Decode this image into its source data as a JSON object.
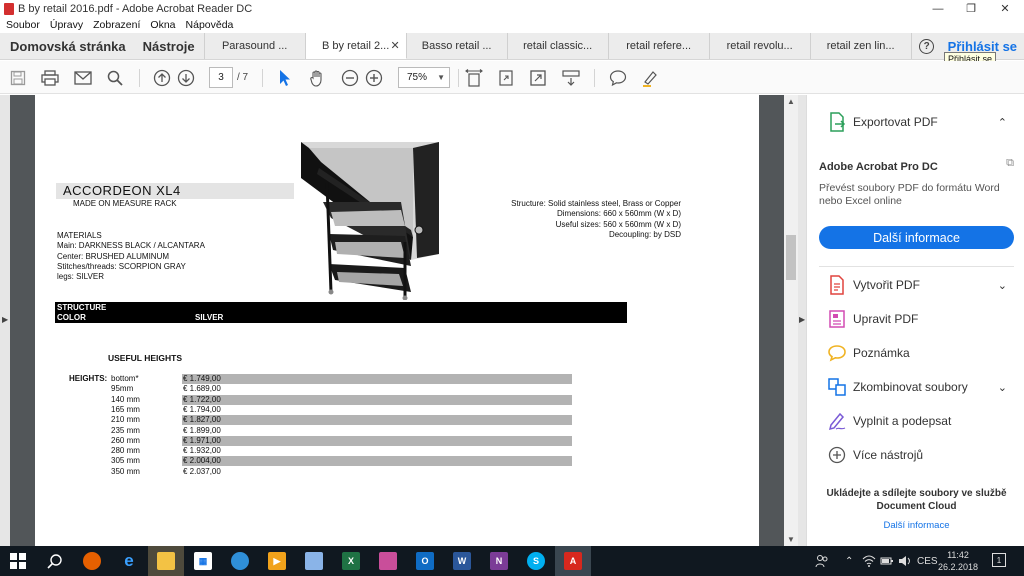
{
  "window": {
    "title": "B by retail 2016.pdf - Adobe Acrobat Reader DC",
    "minimize_label": "—",
    "maximize_label": "❐",
    "close_label": "✕"
  },
  "menubar": [
    "Soubor",
    "Úpravy",
    "Zobrazení",
    "Okna",
    "Nápověda"
  ],
  "tabbar": {
    "home": "Domovská stránka",
    "tools": "Nástroje",
    "tabs": [
      {
        "label": "Parasound ...",
        "active": false
      },
      {
        "label": "B by retail 2...",
        "active": true
      },
      {
        "label": "Basso retail ...",
        "active": false
      },
      {
        "label": "retail classic...",
        "active": false
      },
      {
        "label": "retail refere...",
        "active": false
      },
      {
        "label": "retail revolu...",
        "active": false
      },
      {
        "label": "retail zen lin...",
        "active": false
      }
    ],
    "close_tab": "✕",
    "help": "?",
    "signin": "Přihlásit se",
    "tooltip": "Přihlásit se"
  },
  "toolbar": {
    "page_current": "3",
    "page_total": "/ 7",
    "zoom": "75%"
  },
  "document": {
    "title": "ACCORDEON XL4",
    "subtitle": "MADE ON MEASURE RACK",
    "materials": [
      "MATERIALS",
      "Main: DARKNESS BLACK / ALCANTARA",
      "Center: BRUSHED ALUMINUM",
      "Stitches/threads: SCORPION GRAY",
      "legs: SILVER"
    ],
    "specs": [
      "Structure: Solid stainless steel, Brass or Copper",
      "Dimensions: 660 x 560mm (W x D)",
      "Useful sizes: 560 x 560mm (W x D)",
      "Decoupling: by DSD"
    ],
    "band": {
      "structure": "STRUCTURE",
      "color": "COLOR",
      "color_value": "SILVER"
    },
    "useful_heights_title": "USEFUL HEIGHTS",
    "heights_label": "HEIGHTS:",
    "heights": [
      {
        "size": "bottom*",
        "price": "€ 1.749,00",
        "shaded": true
      },
      {
        "size": "95mm",
        "price": "€ 1.689,00",
        "shaded": false
      },
      {
        "size": "140 mm",
        "price": "€ 1.722,00",
        "shaded": true
      },
      {
        "size": "165 mm",
        "price": "€ 1.794,00",
        "shaded": false
      },
      {
        "size": "210 mm",
        "price": "€ 1.827,00",
        "shaded": true
      },
      {
        "size": "235 mm",
        "price": "€ 1.899,00",
        "shaded": false
      },
      {
        "size": "260 mm",
        "price": "€ 1.971,00",
        "shaded": true
      },
      {
        "size": "280 mm",
        "price": "€ 1.932,00",
        "shaded": false
      },
      {
        "size": "305 mm",
        "price": "€ 2.004,00",
        "shaded": true
      },
      {
        "size": "350 mm",
        "price": "€ 2.037,00",
        "shaded": false
      }
    ]
  },
  "right_panel": {
    "export": "Exportovat PDF",
    "product": "Adobe Acrobat Pro DC",
    "description": "Převést soubory PDF do formátu Word nebo Excel online",
    "more_button": "Další informace",
    "tools": [
      {
        "label": "Vytvořit PDF",
        "expandable": true,
        "icon": "create-pdf-icon",
        "color": "#e0443e"
      },
      {
        "label": "Upravit PDF",
        "expandable": false,
        "icon": "edit-pdf-icon",
        "color": "#d24bb3"
      },
      {
        "label": "Poznámka",
        "expandable": false,
        "icon": "comment-icon",
        "color": "#f0b323"
      },
      {
        "label": "Zkombinovat soubory",
        "expandable": true,
        "icon": "combine-files-icon",
        "color": "#1473e6"
      },
      {
        "label": "Vyplnit a podepsat",
        "expandable": false,
        "icon": "fill-sign-icon",
        "color": "#7a5ad6"
      },
      {
        "label": "Více nástrojů",
        "expandable": false,
        "icon": "more-tools-icon",
        "color": "#555555"
      }
    ],
    "cloud_text": "Ukládejte a sdílejte soubory ve službě Document Cloud",
    "cloud_link": "Další informace"
  },
  "taskbar": {
    "language": "CES",
    "time": "11:42",
    "date": "26.2.2018"
  }
}
